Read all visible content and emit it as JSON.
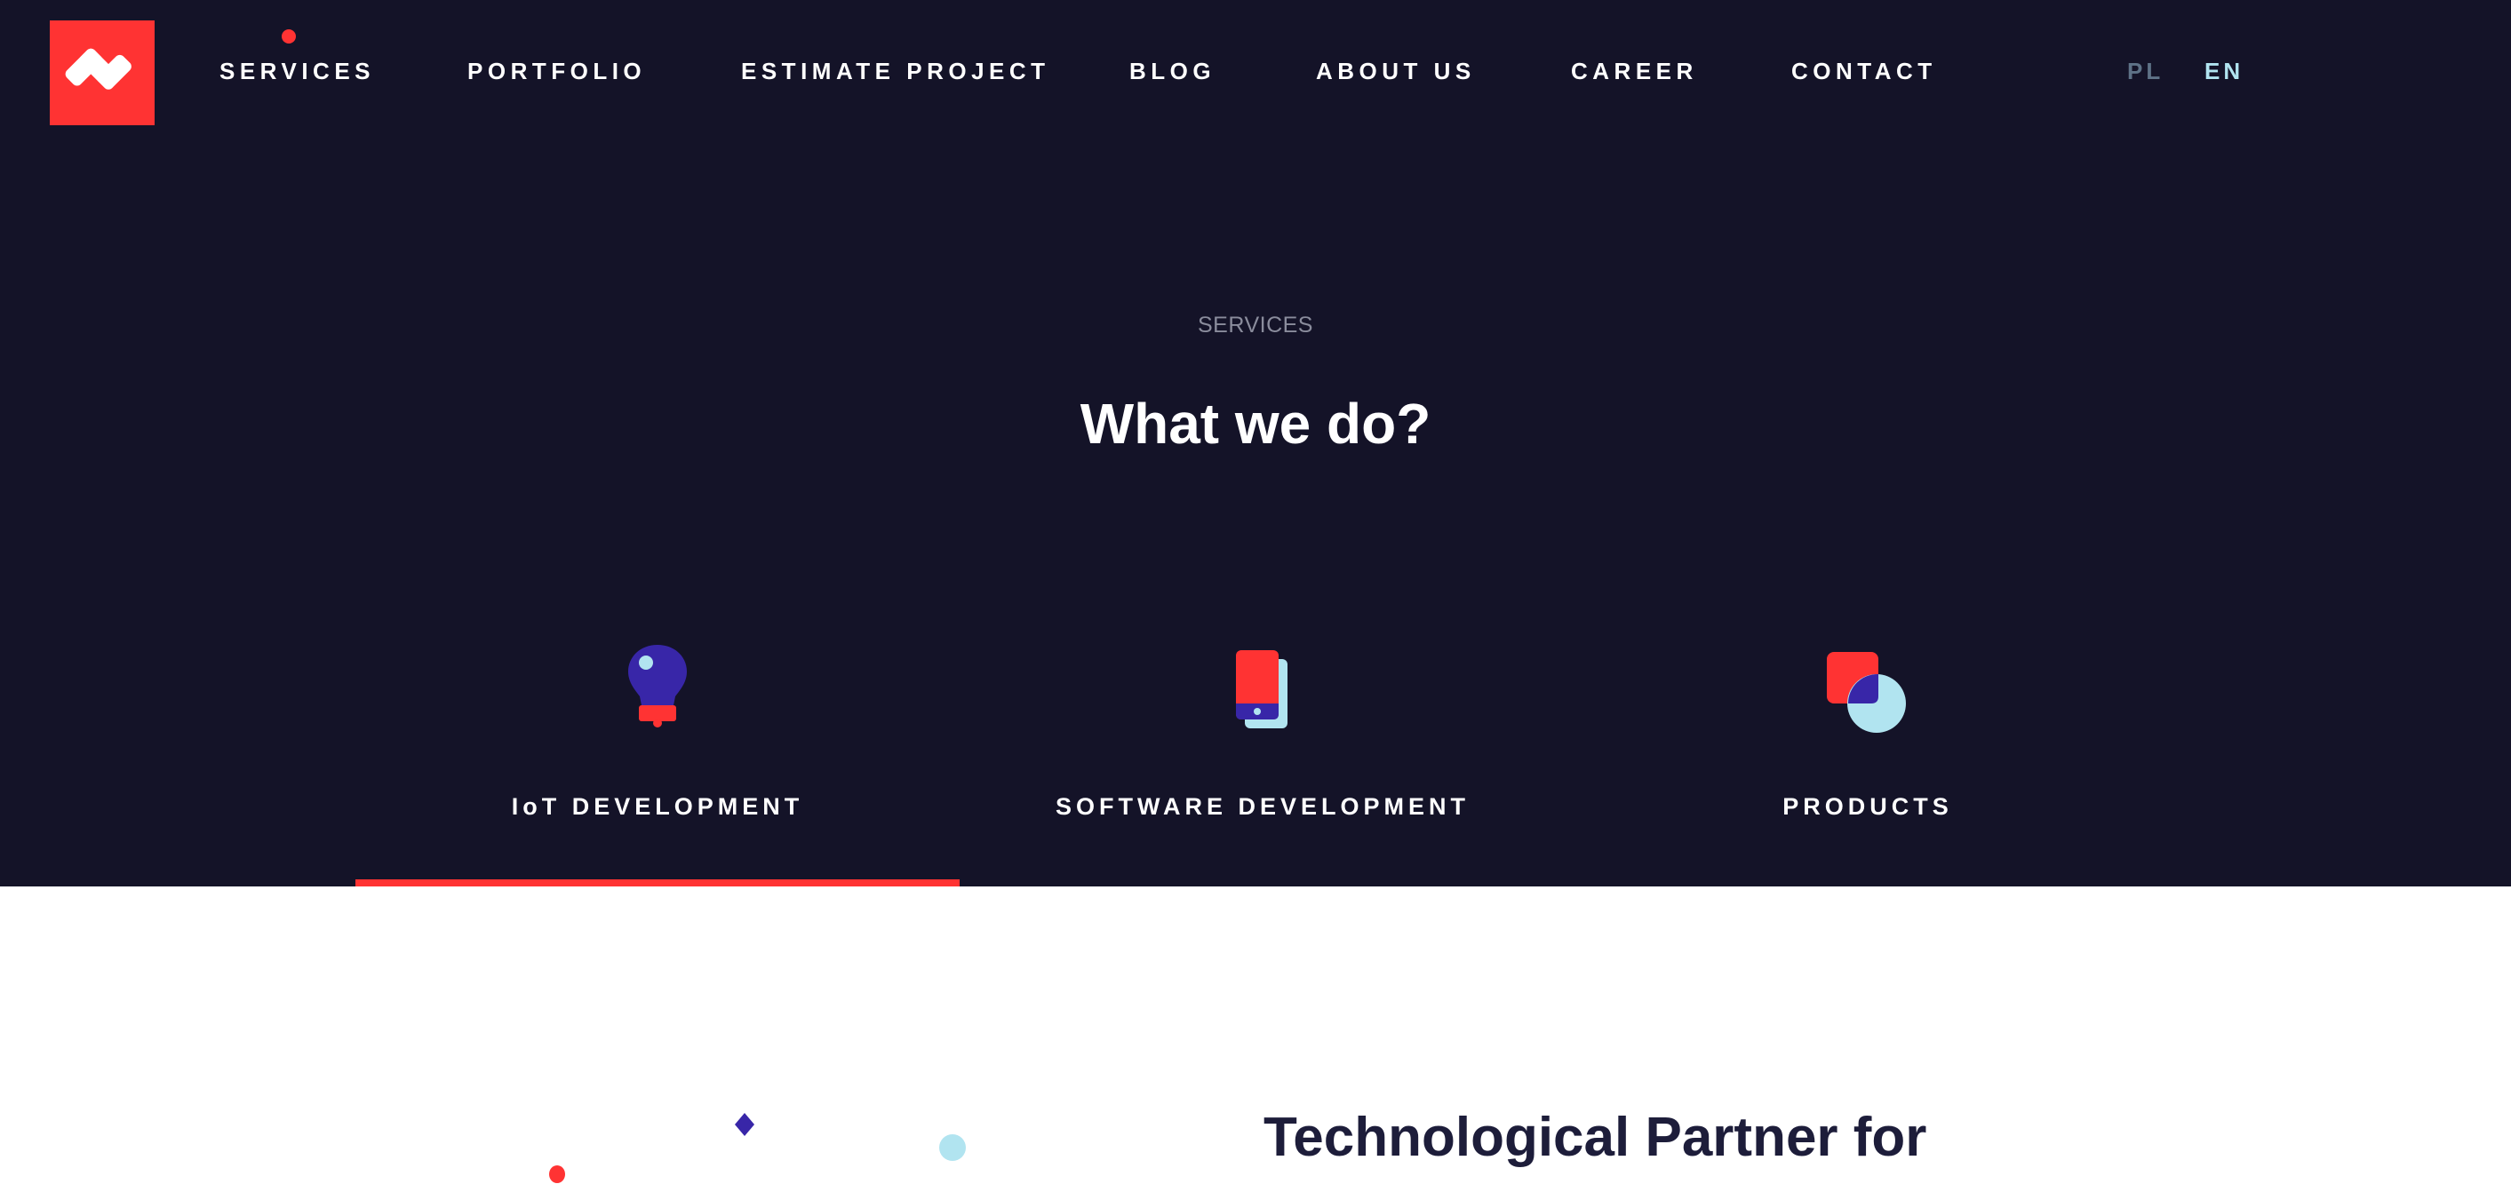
{
  "brand": {
    "logo_icon": "company-logo-mark",
    "colors": {
      "background_dark": "#141328",
      "accent_red": "#ff3333",
      "accent_indigo": "#3826a8",
      "accent_light_blue": "#b1e4f0",
      "muted_text": "#8a8c9c",
      "heading_dark": "#1d1d3a"
    }
  },
  "nav": {
    "items": [
      {
        "label": "SERVICES",
        "active": true
      },
      {
        "label": "PORTFOLIO"
      },
      {
        "label": "ESTIMATE PROJECT"
      },
      {
        "label": "BLOG"
      },
      {
        "label": "ABOUT US"
      },
      {
        "label": "CAREER"
      },
      {
        "label": "CONTACT"
      }
    ],
    "languages": [
      {
        "label": "PL",
        "active": false
      },
      {
        "label": "EN",
        "active": true
      }
    ]
  },
  "hero": {
    "eyebrow": "SERVICES",
    "title": "What we do?"
  },
  "tabs": [
    {
      "label": "IoT DEVELOPMENT",
      "icon": "lightbulb-icon",
      "active": true
    },
    {
      "label": "SOFTWARE DEVELOPMENT",
      "icon": "smartphone-icon",
      "active": false
    },
    {
      "label": "PRODUCTS",
      "icon": "shapes-icon",
      "active": false
    }
  ],
  "content": {
    "heading": "Technological Partner for"
  }
}
